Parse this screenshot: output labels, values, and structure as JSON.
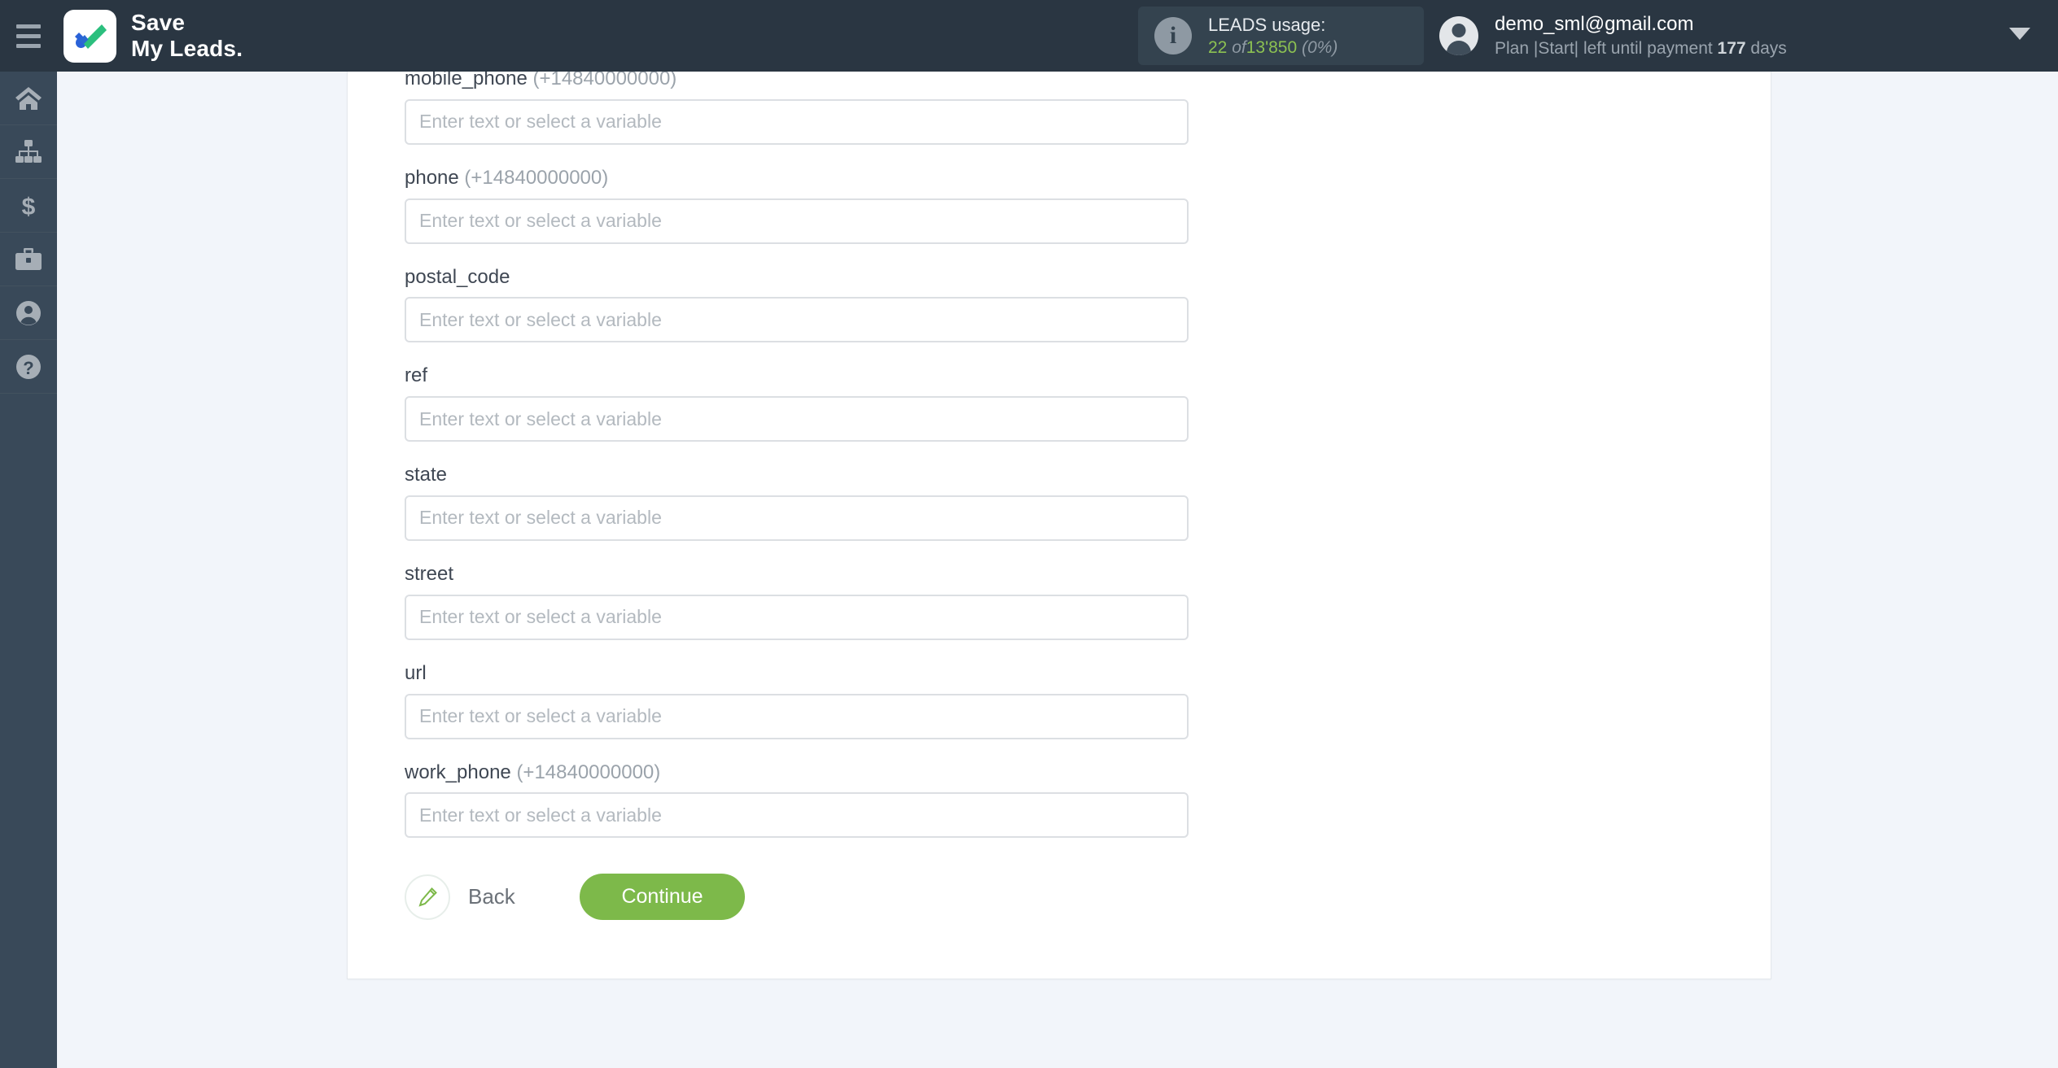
{
  "header": {
    "menu_icon": "hamburger-icon",
    "brand_line1": "Save",
    "brand_line2": "My Leads.",
    "usage": {
      "icon": "info-icon",
      "title": "LEADS usage:",
      "used": "22",
      "of": "of",
      "total": "13'850",
      "percent": "(0%)"
    },
    "account": {
      "avatar_icon": "user-avatar-icon",
      "email": "demo_sml@gmail.com",
      "plan_prefix": "Plan |Start| left until payment ",
      "plan_days": "177",
      "plan_suffix": " days",
      "caret_icon": "chevron-down-icon"
    }
  },
  "sidebar": {
    "items": [
      {
        "name": "home",
        "icon": "home-icon"
      },
      {
        "name": "connections",
        "icon": "sitemap-icon"
      },
      {
        "name": "billing",
        "icon": "dollar-icon"
      },
      {
        "name": "services",
        "icon": "briefcase-icon"
      },
      {
        "name": "profile",
        "icon": "user-circle-icon"
      },
      {
        "name": "help",
        "icon": "question-circle-icon"
      }
    ]
  },
  "form": {
    "placeholder": "Enter text or select a variable",
    "fields": [
      {
        "label": "",
        "hint": "",
        "value": "",
        "clipped": true
      },
      {
        "label": "mobile_phone",
        "hint": "(+14840000000)",
        "value": ""
      },
      {
        "label": "phone",
        "hint": "(+14840000000)",
        "value": ""
      },
      {
        "label": "postal_code",
        "hint": "",
        "value": ""
      },
      {
        "label": "ref",
        "hint": "",
        "value": ""
      },
      {
        "label": "state",
        "hint": "",
        "value": ""
      },
      {
        "label": "street",
        "hint": "",
        "value": ""
      },
      {
        "label": "url",
        "hint": "",
        "value": ""
      },
      {
        "label": "work_phone",
        "hint": "(+14840000000)",
        "value": ""
      }
    ]
  },
  "actions": {
    "back_label": "Back",
    "back_icon": "pencil-icon",
    "continue_label": "Continue"
  },
  "colors": {
    "header_bg": "#2a3642",
    "sidebar_bg": "#394959",
    "page_bg": "#f2f5fa",
    "accent_green": "#7db94a",
    "usage_green": "#8cc152"
  }
}
